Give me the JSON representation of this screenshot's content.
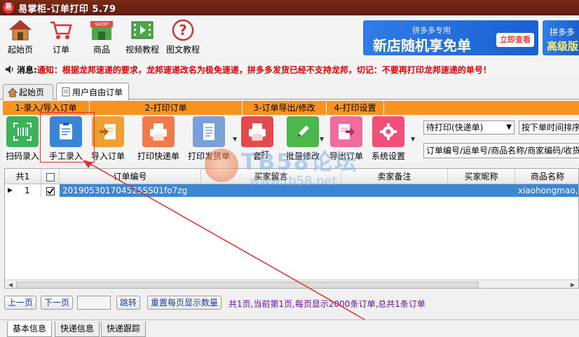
{
  "window": {
    "title": "易掌柜-订单打印 5.79",
    "app_icon_char": "易"
  },
  "main_toolbar": [
    {
      "label": "起始页",
      "icon": "home-icon"
    },
    {
      "label": "订单",
      "icon": "cart-icon"
    },
    {
      "label": "商品",
      "icon": "shop-icon"
    },
    {
      "label": "视频教程",
      "icon": "film-icon"
    },
    {
      "label": "图文教程",
      "icon": "help-icon"
    }
  ],
  "shop_icon_text": "SHOP",
  "ads": {
    "banner1": {
      "subtitle": "拼多多专用",
      "title": "新店随机享免单",
      "button": "立即查看"
    },
    "banner2": {
      "line1": "拼多多",
      "line2": "高级版"
    }
  },
  "notice": {
    "label": "消息:",
    "text": "通知：根据龙邦速递的要求，龙邦速递改名为极免速递，拼多多发货已经不支持龙邦，切记：不要再打印龙邦速递的单号！"
  },
  "tabs": [
    {
      "label": "起始页",
      "active": false
    },
    {
      "label": "用户自由订单",
      "active": true
    }
  ],
  "sections": [
    "1-录入/导入订单",
    "2-打印订单",
    "3-订单导出/修改",
    "4-打印设置"
  ],
  "actions": [
    {
      "label": "扫码录入",
      "icon": "barcode-scan-icon",
      "color": "#3bb35a"
    },
    {
      "label": "手工录入",
      "icon": "clipboard-edit-icon",
      "color": "#3a86d6"
    },
    {
      "label": "导入订单",
      "icon": "import-icon",
      "color": "#f0a032"
    },
    {
      "label": "打印快递单",
      "icon": "printer-icon",
      "color": "#f07a4a"
    },
    {
      "label": "打印发货单",
      "icon": "document-icon",
      "color": "#7aa0d8"
    },
    {
      "label": "套",
      "icon": "print-set-icon",
      "color": "#e34b4b"
    },
    {
      "label": "打",
      "icon": "",
      "color": ""
    },
    {
      "label": "批量修改",
      "icon": "pencil-icon",
      "color": "#4bb84b"
    },
    {
      "label": "导出订单",
      "icon": "export-icon",
      "color": "#f06ca0"
    },
    {
      "label": "系统设置",
      "icon": "gear-icon",
      "color": "#f04f7a"
    }
  ],
  "filters": {
    "status_select": "待打印(快递单)",
    "sort_select": "按下单时间排序",
    "search_placeholder": "订单编号/运单号/商品名称/商家编码/收货"
  },
  "grid": {
    "total_label": "共1",
    "columns": [
      "订单编号",
      "买家留言",
      "卖家备注",
      "买家昵称",
      "商品名称"
    ],
    "rows": [
      {
        "index": "1",
        "checked": true,
        "order_no": "201905301704525SS01fo7zg",
        "buyer_msg": "",
        "seller_note": "",
        "buyer_nick": "",
        "product": "xiaohongmao,"
      }
    ]
  },
  "pager": {
    "prev": "上一页",
    "next": "下一页",
    "page_input": "",
    "jump": "跳转",
    "reset": "重置每页显示数量",
    "info": "共1页,当前第1页,每页显示2000条订单,总共1条订单"
  },
  "bottom_tabs": [
    {
      "label": "基本信息",
      "active": true
    },
    {
      "label": "快递信息",
      "active": false
    },
    {
      "label": "快递跟踪",
      "active": false
    }
  ],
  "watermark": {
    "title": "TB58论坛",
    "url": "www.tb58.net"
  }
}
